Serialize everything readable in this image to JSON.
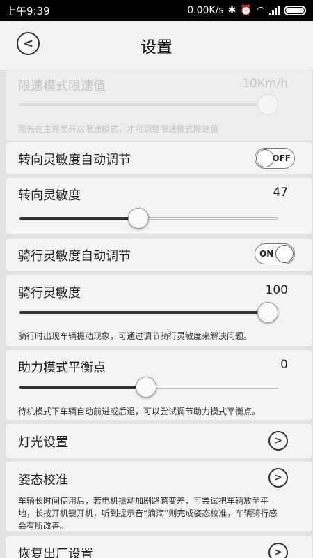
{
  "status_bar": {
    "time": "上午9:39",
    "net_speed": "0.00K/s",
    "icons": [
      "bluetooth-icon",
      "alarm-icon",
      "wifi-icon",
      "signal-icon",
      "battery-icon"
    ]
  },
  "header": {
    "title": "设置",
    "back_icon": "chevron-left-icon"
  },
  "speed_limit": {
    "label": "限速模式限速值",
    "value": "10Km/h",
    "slider_fraction": 1.0,
    "hint": "需先在主界面开启限速模式，才可调整限速模式限速值",
    "disabled": true
  },
  "steering_auto": {
    "label": "转向灵敏度自动调节",
    "state": "OFF"
  },
  "steering_sensitivity": {
    "label": "转向灵敏度",
    "value": "47",
    "slider_fraction": 0.46
  },
  "riding_auto": {
    "label": "骑行灵敏度自动调节",
    "state": "ON"
  },
  "riding_sensitivity": {
    "label": "骑行灵敏度",
    "value": "100",
    "slider_fraction": 1.0,
    "hint": "骑行时出现车辆振动现象，可通过调节骑行灵敏度来解决问题。"
  },
  "balance_point": {
    "label": "助力模式平衡点",
    "value": "0",
    "slider_fraction": 0.49,
    "hint": "待机模式下车辆自动前进或后退，可以尝试调节助力模式平衡点。"
  },
  "light_settings": {
    "label": "灯光设置"
  },
  "posture_calibration": {
    "label": "姿态校准",
    "hint": "车辆长时间使用后，若电机振动加剧路感变差，可尝试把车辆放至平地，长按开机键开机，听到提示音“滴滴”则完成姿态校准，车辆骑行感会有所改善。"
  },
  "factory_reset": {
    "label": "恢复出厂设置"
  },
  "colors": {
    "background": "#e2e2e2",
    "card": "#f4f4f4",
    "accent": "#333333"
  }
}
